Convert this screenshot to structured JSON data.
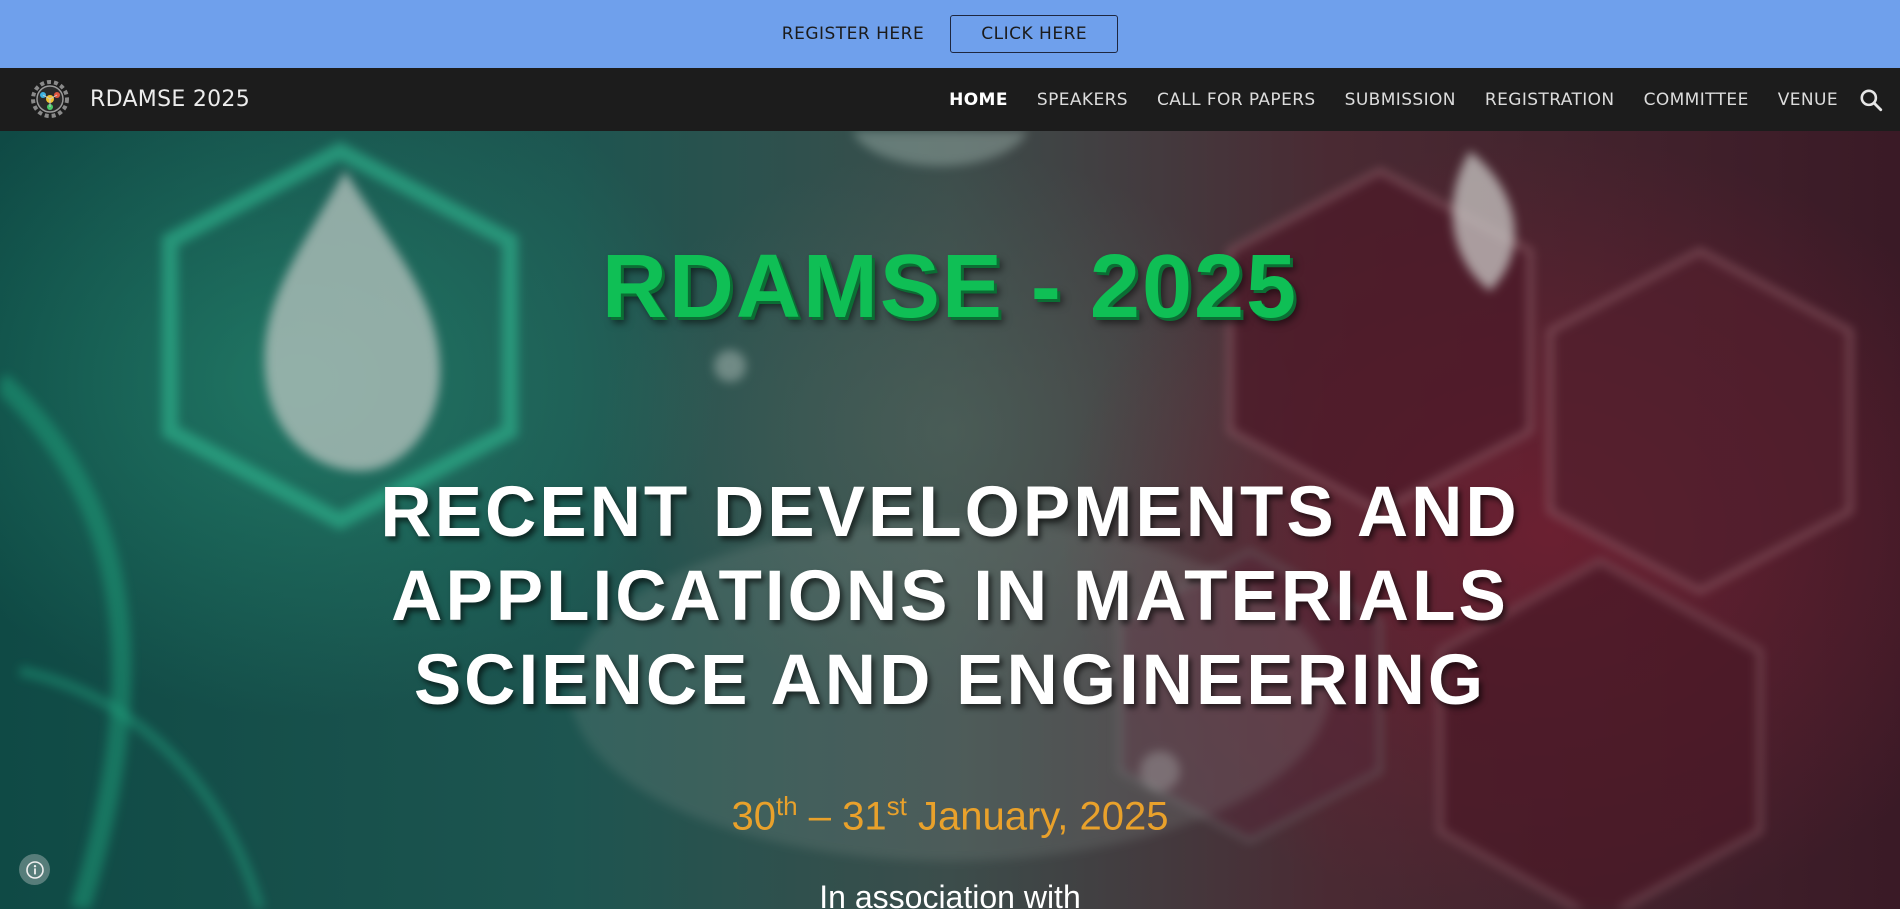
{
  "announcement": {
    "text": "REGISTER HERE",
    "button_label": "CLICK HERE",
    "background_color": "#6fa0ec"
  },
  "navbar": {
    "logo_icon": "gear-atom-logo-icon",
    "site_title": "RDAMSE 2025",
    "links": [
      {
        "label": "HOME",
        "active": true
      },
      {
        "label": "SPEAKERS",
        "active": false
      },
      {
        "label": "CALL FOR PAPERS",
        "active": false
      },
      {
        "label": "SUBMISSION",
        "active": false
      },
      {
        "label": "REGISTRATION",
        "active": false
      },
      {
        "label": "COMMITTEE",
        "active": false
      },
      {
        "label": "VENUE",
        "active": false
      }
    ],
    "search_icon": "search-icon",
    "background_color": "#1c1c1c"
  },
  "hero": {
    "title": "RDAMSE - 2025",
    "subtitle_lines": [
      "RECENT DEVELOPMENTS AND",
      "APPLICATIONS IN MATERIALS",
      "SCIENCE AND ENGINEERING"
    ],
    "dates": {
      "start_day": "30",
      "start_suffix": "th",
      "separator": " – ",
      "end_day": "31",
      "end_suffix": "st",
      "month_year": " January, 2025"
    },
    "association_text": "In association with",
    "title_color": "#0fbf55",
    "dates_color": "#e9a12b"
  },
  "info_button_icon": "info-icon"
}
